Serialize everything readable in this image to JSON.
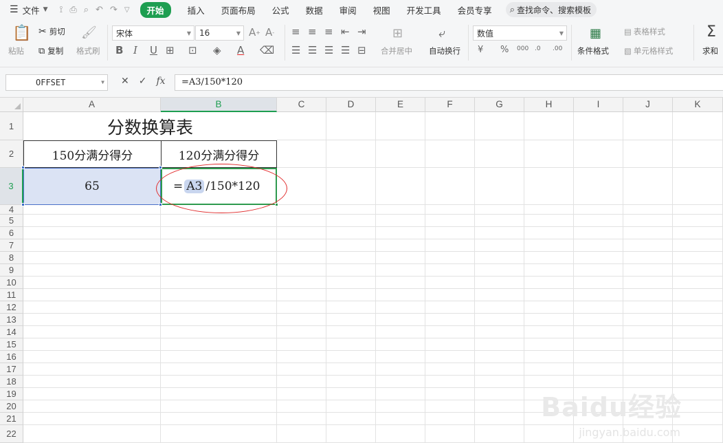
{
  "menubar": {
    "file_label": "文件",
    "active_tab": "开始",
    "tabs": [
      "插入",
      "页面布局",
      "公式",
      "数据",
      "审阅",
      "视图",
      "开发工具",
      "会员专享"
    ],
    "search_label": "查找命令、搜索模板"
  },
  "ribbon": {
    "paste": "粘贴",
    "cut": "剪切",
    "copy": "复制",
    "format_painter": "格式刷",
    "font_name": "宋体",
    "font_size": "16",
    "merge_center": "合并居中",
    "wrap_text": "自动换行",
    "number_format": "数值",
    "conditional_format": "条件格式",
    "table_style": "表格样式",
    "cell_style": "单元格样式",
    "sum": "求和"
  },
  "formula_bar": {
    "name_box": "OFFSET",
    "formula": "=A3/150*120"
  },
  "sheet": {
    "columns": [
      "A",
      "B",
      "C",
      "D",
      "E",
      "F",
      "G",
      "H",
      "I",
      "J",
      "K"
    ],
    "rows": [
      "1",
      "2",
      "3",
      "4",
      "5",
      "6",
      "7",
      "8",
      "9",
      "10",
      "11",
      "12",
      "13",
      "14",
      "15",
      "16",
      "17",
      "18",
      "19",
      "20",
      "21",
      "22"
    ],
    "title": "分数换算表",
    "header_a": "150分满分得分",
    "header_b": "120分满分得分",
    "a3_value": "65",
    "b3_prefix": "=",
    "b3_ref": "A3",
    "b3_suffix": "/150*120"
  },
  "watermark": {
    "brand": "Baidu经验",
    "url": "jingyan.baidu.com"
  }
}
